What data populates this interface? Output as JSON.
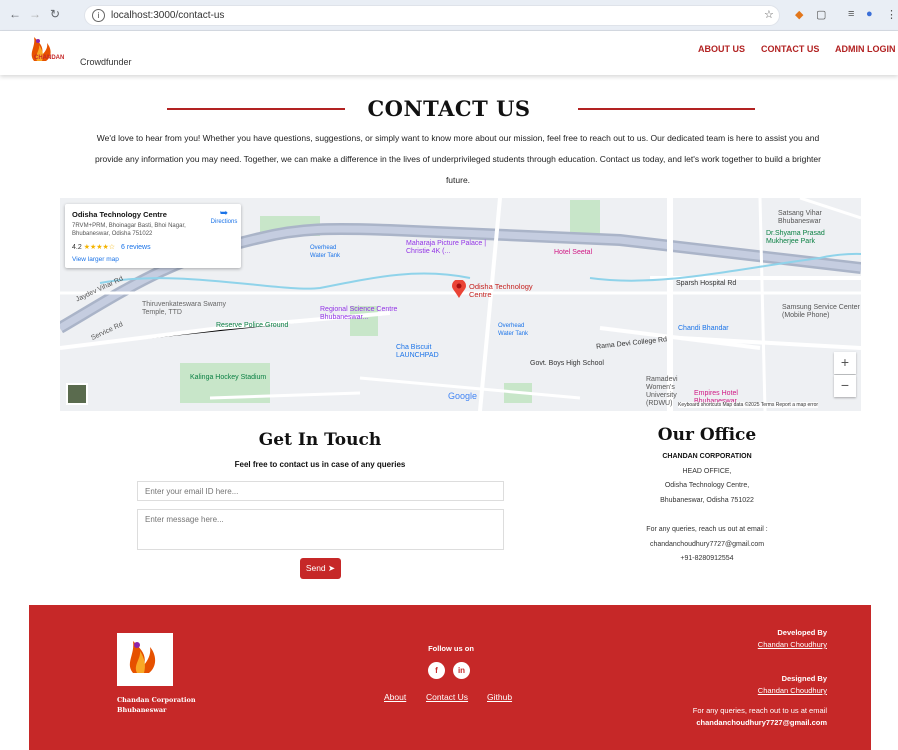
{
  "browser": {
    "url": "localhost:3000/contact-us",
    "back_icon": "arrow-left-icon",
    "forward_icon": "arrow-right-icon",
    "reload_icon": "reload-icon"
  },
  "header": {
    "logo_text": "CHANDAN",
    "brand": "Crowdfunder",
    "menu": [
      "ABOUT US",
      "CONTACT US",
      "ADMIN LOGIN"
    ]
  },
  "page": {
    "title": "CONTACT US",
    "intro_lines": [
      "We'd love to hear from you! Whether you have questions, suggestions, or simply want to know more about our mission, feel free to reach out to us. Our dedicated team is here to assist you and",
      "provide any information you may need. Together, we can make a difference in the lives of underprivileged students through education. Contact us today, and let's work together to build a brighter",
      "future."
    ]
  },
  "map": {
    "place_name": "Odisha Technology Centre",
    "address": "7RVM+PRM, Bhoinagar Basti, Bhoi Nagar, Bhubaneswar, Odisha 751022",
    "rating": "4.2",
    "stars": "★★★★☆",
    "reviews": "6 reviews",
    "view_larger": "View larger map",
    "directions": "Directions",
    "pin_label": "Odisha Technology Centre",
    "labels": {
      "satsang": "Satsang Vihar Bhubaneswar",
      "shyama": "Dr.Shyama Prasad Mukherjee Park",
      "maharaja": "Maharaja Picture Palace | Christie 4K (...",
      "hotel_seetal": "Hotel Seetal",
      "overhead1": "Overhead Water Tank",
      "overhead2": "Overhead Water Tank",
      "trivenkatesh": "Thiruvenkateswara Swamy Temple, TTD",
      "regional": "Regional Science Centre Bhubaneswar...",
      "reserve": "Reserve Police Ground",
      "sparsh": "Sparsh Hospital Rd",
      "samsung": "Samsung Service Center (Mobile Phone)",
      "chandi": "Chandi Bhandar",
      "ramadevi_rd": "Rama Devi College Rd",
      "cha_biscuit": "Cha Biscuit LAUNCHPAD",
      "govt_boys": "Govt. Boys High School",
      "kalinga": "Kalinga Hockey Stadium",
      "ramadevi_univ": "Ramadevi Women's University (RDWU)",
      "empires": "Empires Hotel Bhubaneswar",
      "service_rd": "Service Rd",
      "jaydev": "Jaydev Vihar Rd",
      "google": "Google",
      "attribution": "Keyboard shortcuts   Map data ©2025   Terms   Report a map error"
    }
  },
  "contact": {
    "title": "Get In Touch",
    "subtitle": "Feel free to contact us in case of any queries",
    "email_placeholder": "Enter your email ID here...",
    "message_placeholder": "Enter message here...",
    "send_label": "Send"
  },
  "office": {
    "title": "Our Office",
    "lines": [
      "CHANDAN CORPORATION",
      "HEAD OFFICE,",
      "Odisha Technology Centre,",
      "Bhubaneswar, Odisha 751022",
      "For any queries, reach us out at email :",
      "chandanchoudhury7727@gmail.com",
      "+91-8280912554"
    ]
  },
  "footer": {
    "org_name": "Chandan Corporation",
    "org_city": "Bhubaneswar",
    "follow": "Follow us on",
    "social": [
      "f",
      "in"
    ],
    "links": [
      "About",
      "Contact Us",
      "Github"
    ],
    "developed_by": "Developed By",
    "developer": "Chandan Choudhury",
    "designed_by": "Designed By",
    "designer": "Chandan Choudhury",
    "queries": "For any queries, reach out to us at email",
    "email": "chandanchoudhury7727@gmail.com"
  },
  "colors": {
    "accent": "#c62828",
    "map_road": "#aab4c8",
    "map_park": "#c8e6c9"
  }
}
